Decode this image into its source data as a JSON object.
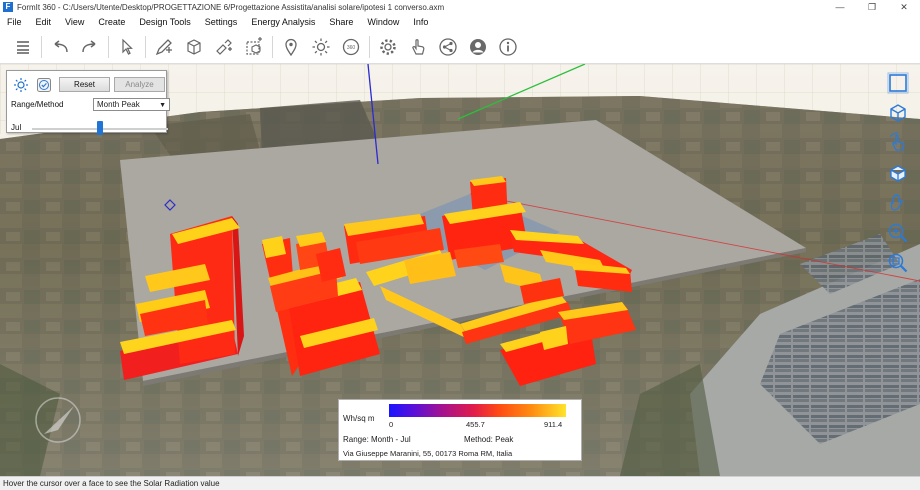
{
  "window": {
    "title": "FormIt 360 - C:/Users/Utente/Desktop/PROGETTAZIONE 6/Progettazione Assistita/analisi solare/ipotesi 1 converso.axm",
    "logo_letter": "F",
    "controls": [
      "—",
      "❐",
      "✕"
    ]
  },
  "menu": [
    "File",
    "Edit",
    "View",
    "Create",
    "Design Tools",
    "Settings",
    "Energy Analysis",
    "Share",
    "Window",
    "Info"
  ],
  "toolbar": {
    "icons": [
      "layers-icon",
      "undo-icon",
      "redo-icon",
      "select-icon",
      "sketch-icon",
      "cube-icon",
      "paint-icon",
      "group-icon",
      "location-icon",
      "sun-icon",
      "solar-analysis-icon",
      "settings-icon",
      "touch-icon",
      "share-icon",
      "user-icon",
      "info-icon"
    ]
  },
  "solar_panel": {
    "reset_label": "Reset",
    "analyze_label": "Analyze",
    "range_label": "Range/Method",
    "method_value": "Month Peak",
    "month_label": "Jul",
    "month_position": 0.5
  },
  "nav": {
    "icons": [
      "zoom-extents-icon",
      "view-cube-icon",
      "orbit-icon",
      "look-around-icon",
      "pan-hand-icon",
      "zoom-in-icon",
      "zoom-fit-icon"
    ]
  },
  "legend": {
    "unit": "Wh/sq m",
    "min": "0",
    "mid": "455.7",
    "max": "911.4",
    "range_text": "Range: Month - Jul",
    "method_text": "Method: Peak",
    "address": "Via Giuseppe Maranini, 55, 00173 Roma RM, Italia",
    "colors": [
      "#1a14ff",
      "#a41290",
      "#e11c4a",
      "#ff8a10",
      "#ffe42a"
    ]
  },
  "status": "Hover the cursor over a face to see the Solar Radiation value"
}
